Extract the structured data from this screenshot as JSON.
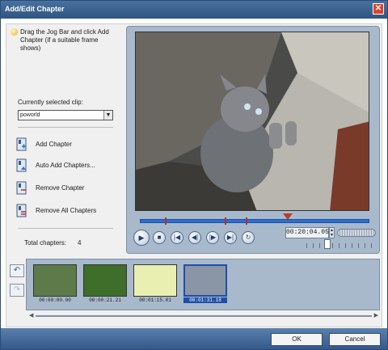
{
  "window": {
    "title": "Add/Edit Chapter",
    "close_label": "✕"
  },
  "hint": {
    "text": "Drag the Jog Bar and click Add Chapter (if a suitable frame shows)"
  },
  "clip": {
    "label": "Currently selected clip:",
    "value": "poworld"
  },
  "actions": {
    "add": "Add Chapter",
    "auto_add": "Auto Add Chapters...",
    "remove": "Remove Chapter",
    "remove_all": "Remove All Chapters"
  },
  "totals": {
    "label": "Total chapters:",
    "count": "4"
  },
  "player": {
    "timecode": "00:20:04.05",
    "chapter_markers_fraction": [
      0.11,
      0.37,
      0.46
    ],
    "jog_position_fraction": 0.63
  },
  "chapters": [
    {
      "timecode": "00:00:00.00",
      "color": "#5d7a4a"
    },
    {
      "timecode": "00:00:21.21",
      "color": "#3f6d2a"
    },
    {
      "timecode": "00:01:15.01",
      "color": "#e9efb0"
    },
    {
      "timecode": "00:01:31.18",
      "color": "#8a96a6",
      "selected": true
    }
  ],
  "footer": {
    "ok": "OK",
    "cancel": "Cancel"
  },
  "colors": {
    "titlebar": "#2f5583",
    "accent": "#1e4fa8",
    "timeline": "#2c6fd1",
    "marker": "#b03030"
  }
}
